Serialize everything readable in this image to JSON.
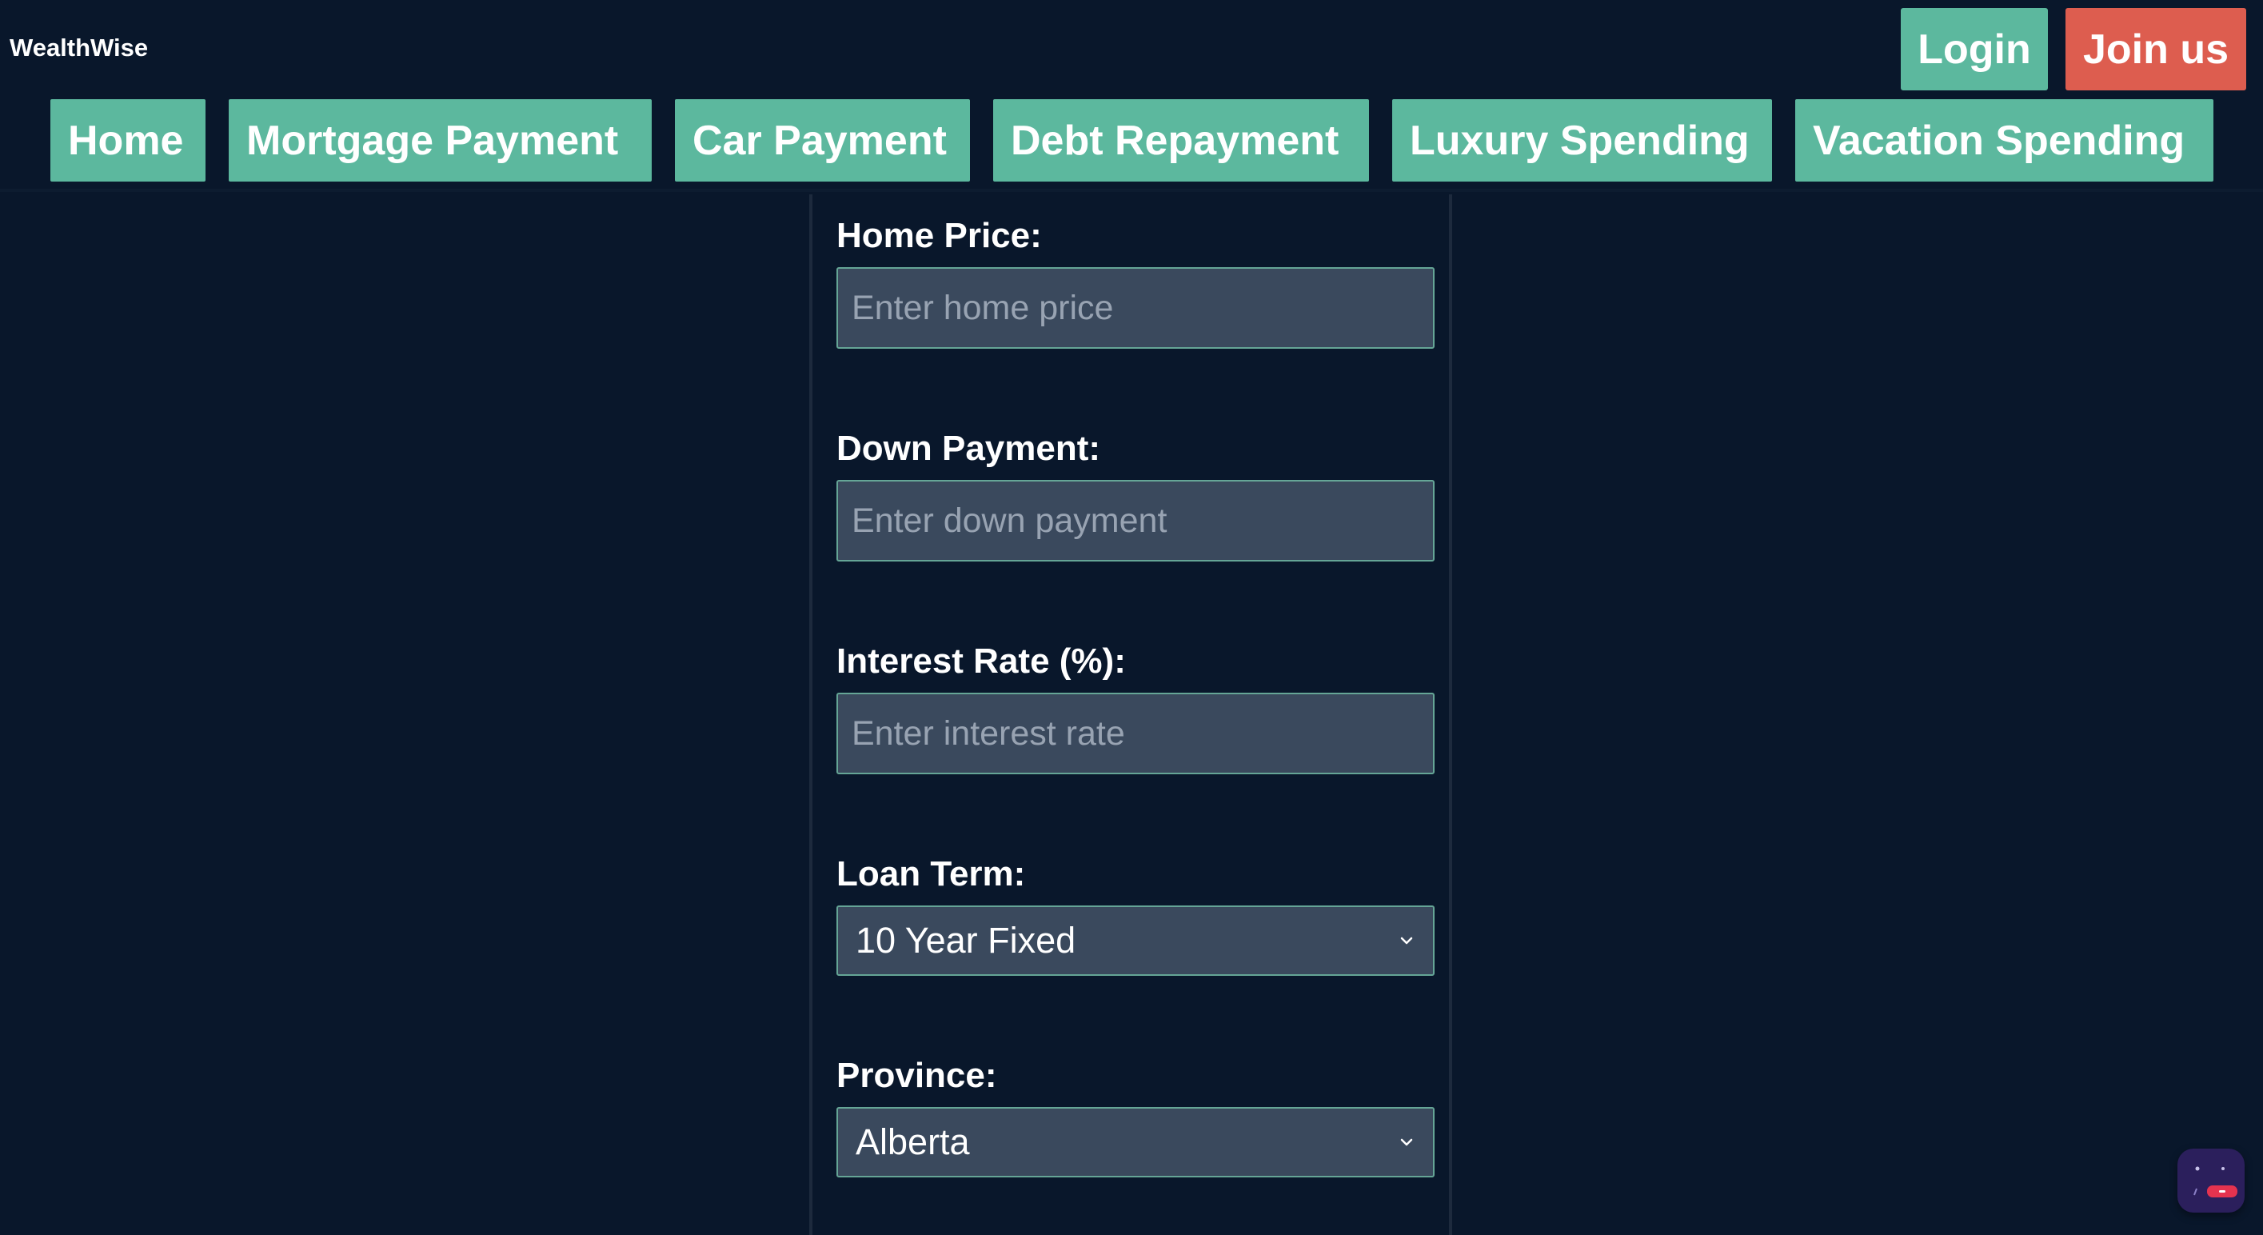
{
  "app": {
    "brand": "WealthWise"
  },
  "auth": {
    "login_label": "Login",
    "join_label": "Join us"
  },
  "nav": {
    "items": [
      {
        "label": "Home"
      },
      {
        "label": "Mortgage Payment"
      },
      {
        "label": "Car Payment"
      },
      {
        "label": "Debt Repayment"
      },
      {
        "label": "Luxury Spending"
      },
      {
        "label": "Vacation Spending"
      }
    ]
  },
  "form": {
    "home_price": {
      "label": "Home Price:",
      "value": "",
      "placeholder": "Enter home price"
    },
    "down_payment": {
      "label": "Down Payment:",
      "value": "",
      "placeholder": "Enter down payment"
    },
    "interest_rate": {
      "label": "Interest Rate (%):",
      "value": "",
      "placeholder": "Enter interest rate"
    },
    "loan_term": {
      "label": "Loan Term:",
      "selected": "10 Year Fixed",
      "icon": "chevron-down-icon"
    },
    "province": {
      "label": "Province:",
      "selected": "Alberta",
      "icon": "chevron-down-icon"
    }
  },
  "colors": {
    "background": "#09172b",
    "accent": "#5cb89e",
    "join_accent": "#dd5d4f",
    "input_background": "#3a495d",
    "input_border": "#65a596"
  },
  "widgets": {
    "chat_icon": "chat-assistant-icon"
  }
}
